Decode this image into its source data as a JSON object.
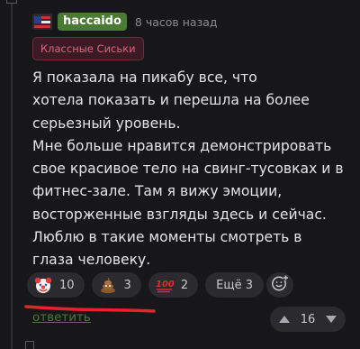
{
  "comment": {
    "username": "haccaido",
    "time": "8 часов назад",
    "badge": "Классные Сиськи",
    "lines": [
      "Я показала на пикабу все, что",
      "хотела показать и перешла на более",
      "серьезный уровень.",
      "Мне больше нравится демонстрировать",
      "свое красивое тело на свинг-тусовках и в",
      "фитнес-зале. Там я вижу эмоции,",
      "восторженные взгляды здесь и сейчас.",
      "Люблю в такие моменты смотреть в",
      "глаза человеку."
    ]
  },
  "reactions": [
    {
      "icon": "clown-emoji-icon",
      "count": "10"
    },
    {
      "icon": "poop-emoji-icon",
      "count": "3"
    },
    {
      "icon": "hundred-emoji-icon",
      "count": "2"
    }
  ],
  "more_reactions": "Ещё 3",
  "reply_label": "ответить",
  "rating": "16",
  "colors": {
    "username_bg": "#4a7a33",
    "badge_text": "#e0637f",
    "annotation_red": "#e8212b"
  }
}
